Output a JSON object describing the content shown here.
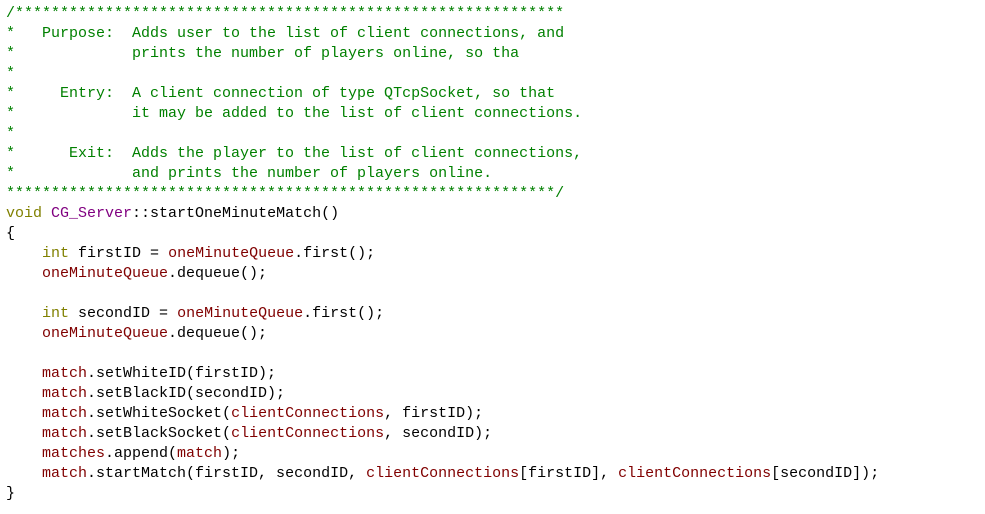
{
  "editor": {
    "comment": {
      "top_border": "/*************************************************************",
      "purpose_1": "*   Purpose:  Adds user to the list of client connections, and",
      "purpose_2": "*             prints the number of players online, so tha",
      "star_1": "*",
      "entry_1": "*     Entry:  A client connection of type QTcpSocket, so that",
      "entry_2": "*             it may be added to the list of client connections.",
      "star_2": "*",
      "exit_1": "*      Exit:  Adds the player to the list of client connections,",
      "exit_2": "*             and prints the number of players online.",
      "bottom_border": "*************************************************************/"
    },
    "code": {
      "sig_void": "void",
      "sig_class": "CG_Server",
      "sig_rest": "::startOneMinuteMatch()",
      "brace_open": "{",
      "l1_int": "int",
      "l1_var": " firstID = ",
      "l1_queue": "oneMinuteQueue",
      "l1_call": ".first();",
      "l2_queue": "oneMinuteQueue",
      "l2_call": ".dequeue();",
      "l3_int": "int",
      "l3_var": " secondID = ",
      "l3_queue": "oneMinuteQueue",
      "l3_call": ".first();",
      "l4_queue": "oneMinuteQueue",
      "l4_call": ".dequeue();",
      "l5_obj": "match",
      "l5_call": ".setWhiteID(firstID);",
      "l6_obj": "match",
      "l6_call": ".setBlackID(secondID);",
      "l7_obj": "match",
      "l7_call": ".setWhiteSocket(",
      "l7_arg": "clientConnections",
      "l7_rest": ", firstID);",
      "l8_obj": "match",
      "l8_call": ".setBlackSocket(",
      "l8_arg": "clientConnections",
      "l8_rest": ", secondID);",
      "l9_obj": "matches",
      "l9_call": ".append(",
      "l9_arg": "match",
      "l9_rest": ");",
      "l10_obj": "match",
      "l10_call": ".startMatch(firstID, secondID, ",
      "l10_arg1": "clientConnections",
      "l10_mid": "[firstID], ",
      "l10_arg2": "clientConnections",
      "l10_rest": "[secondID]);",
      "brace_close": "}"
    },
    "colors": {
      "comment": "#008000",
      "keyword": "#808000",
      "member": "#800000",
      "type": "#800080",
      "background": "#ffffff"
    }
  }
}
